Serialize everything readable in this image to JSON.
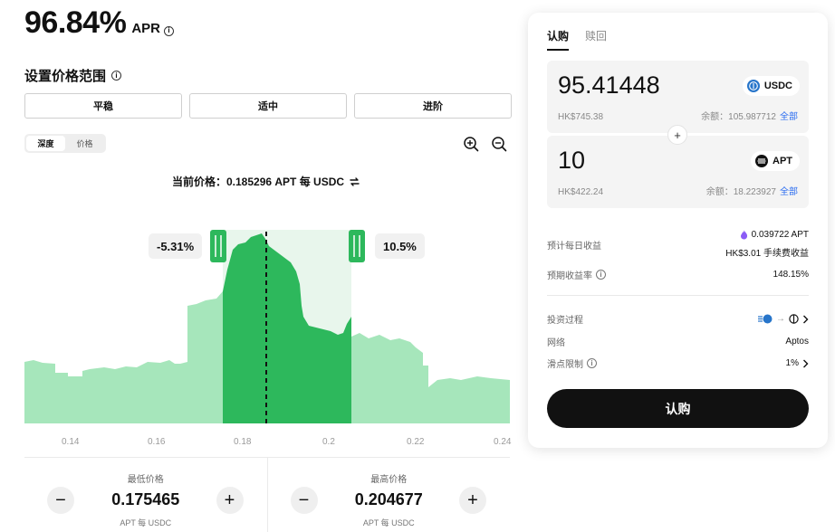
{
  "apr": {
    "value": "96.84%",
    "label": "APR"
  },
  "range": {
    "title": "设置价格范围",
    "presets": [
      "平稳",
      "适中",
      "进阶"
    ],
    "view_toggle": {
      "depth": "深度",
      "price": "价格",
      "active": "depth"
    }
  },
  "current_price": "当前价格：0.185296 APT 每 USDC",
  "chart": {
    "low_pct": "-5.31%",
    "high_pct": "10.5%",
    "x_ticks": [
      "0.14",
      "0.16",
      "0.18",
      "0.2",
      "0.22",
      "0.24"
    ],
    "current_price_value": 0.185296,
    "range_min": 0.175465,
    "range_max": 0.204677
  },
  "price_inputs": {
    "min": {
      "title": "最低价格",
      "value": "0.175465",
      "unit": "APT 每 USDC",
      "minus": "−",
      "plus": "+"
    },
    "max": {
      "title": "最高价格",
      "value": "0.204677",
      "unit": "APT 每 USDC",
      "minus": "−",
      "plus": "+"
    }
  },
  "card": {
    "tabs": [
      "认购",
      "赎回"
    ],
    "active_tab": 0,
    "token1": {
      "amount": "95.41448",
      "symbol": "USDC",
      "fiat": "HK$745.38",
      "balance_label": "余额：105.987712",
      "max": "全部"
    },
    "plus": "+",
    "token2": {
      "amount": "10",
      "symbol": "APT",
      "fiat": "HK$422.24",
      "balance_label": "余额：18.223927",
      "max": "全部"
    },
    "daily_income": {
      "label": "预计每日收益",
      "value1": "0.039722 APT",
      "value2": "HK$3.01 手续费收益"
    },
    "expected_rate": {
      "label": "预期收益率",
      "value": "148.15%"
    },
    "process": {
      "label": "投资过程",
      "arrow": "→"
    },
    "network": {
      "label": "网络",
      "value": "Aptos"
    },
    "slippage": {
      "label": "滑点限制",
      "value": "1%"
    },
    "submit": "认购"
  },
  "colors": {
    "in_range": "#2db85c",
    "out_range": "#a6e6bb",
    "band": "#e8f6ec",
    "accent_link": "#2a6cf0"
  }
}
